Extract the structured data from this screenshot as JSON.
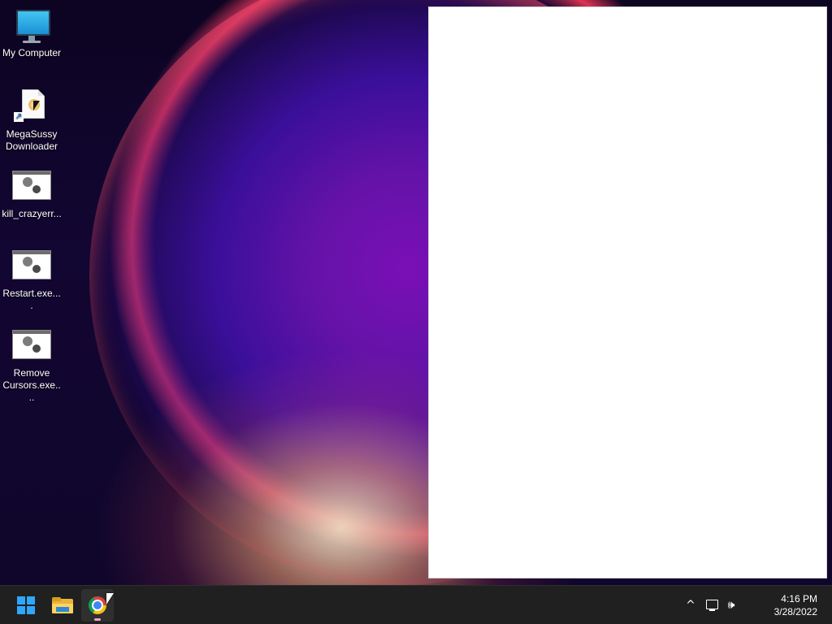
{
  "desktop": {
    "icons": [
      {
        "label": "My Computer",
        "icon": "monitor-icon"
      },
      {
        "label": "MegaSussy Downloader",
        "icon": "shortcut-document-icon"
      },
      {
        "label": "kill_crazyerr...",
        "icon": "executable-icon"
      },
      {
        "label": "Restart.exe....",
        "icon": "executable-icon"
      },
      {
        "label": "Remove Cursors.exe....",
        "icon": "executable-icon"
      }
    ]
  },
  "taskbar": {
    "pinned": [
      {
        "name": "start",
        "icon": "windows-start-icon"
      },
      {
        "name": "file-explorer",
        "icon": "folder-icon"
      },
      {
        "name": "chrome",
        "icon": "chrome-icon",
        "active": true
      }
    ],
    "tray": {
      "overflow_icon": "^",
      "network_icon": "network-icon",
      "volume_icon": "🕪"
    },
    "clock": {
      "time": "4:16 PM",
      "date": "3/28/2022"
    }
  },
  "colors": {
    "taskbar_bg": "#202020",
    "accent": "#2ea7ff",
    "wallpaper_glow": "#7a10b6"
  }
}
